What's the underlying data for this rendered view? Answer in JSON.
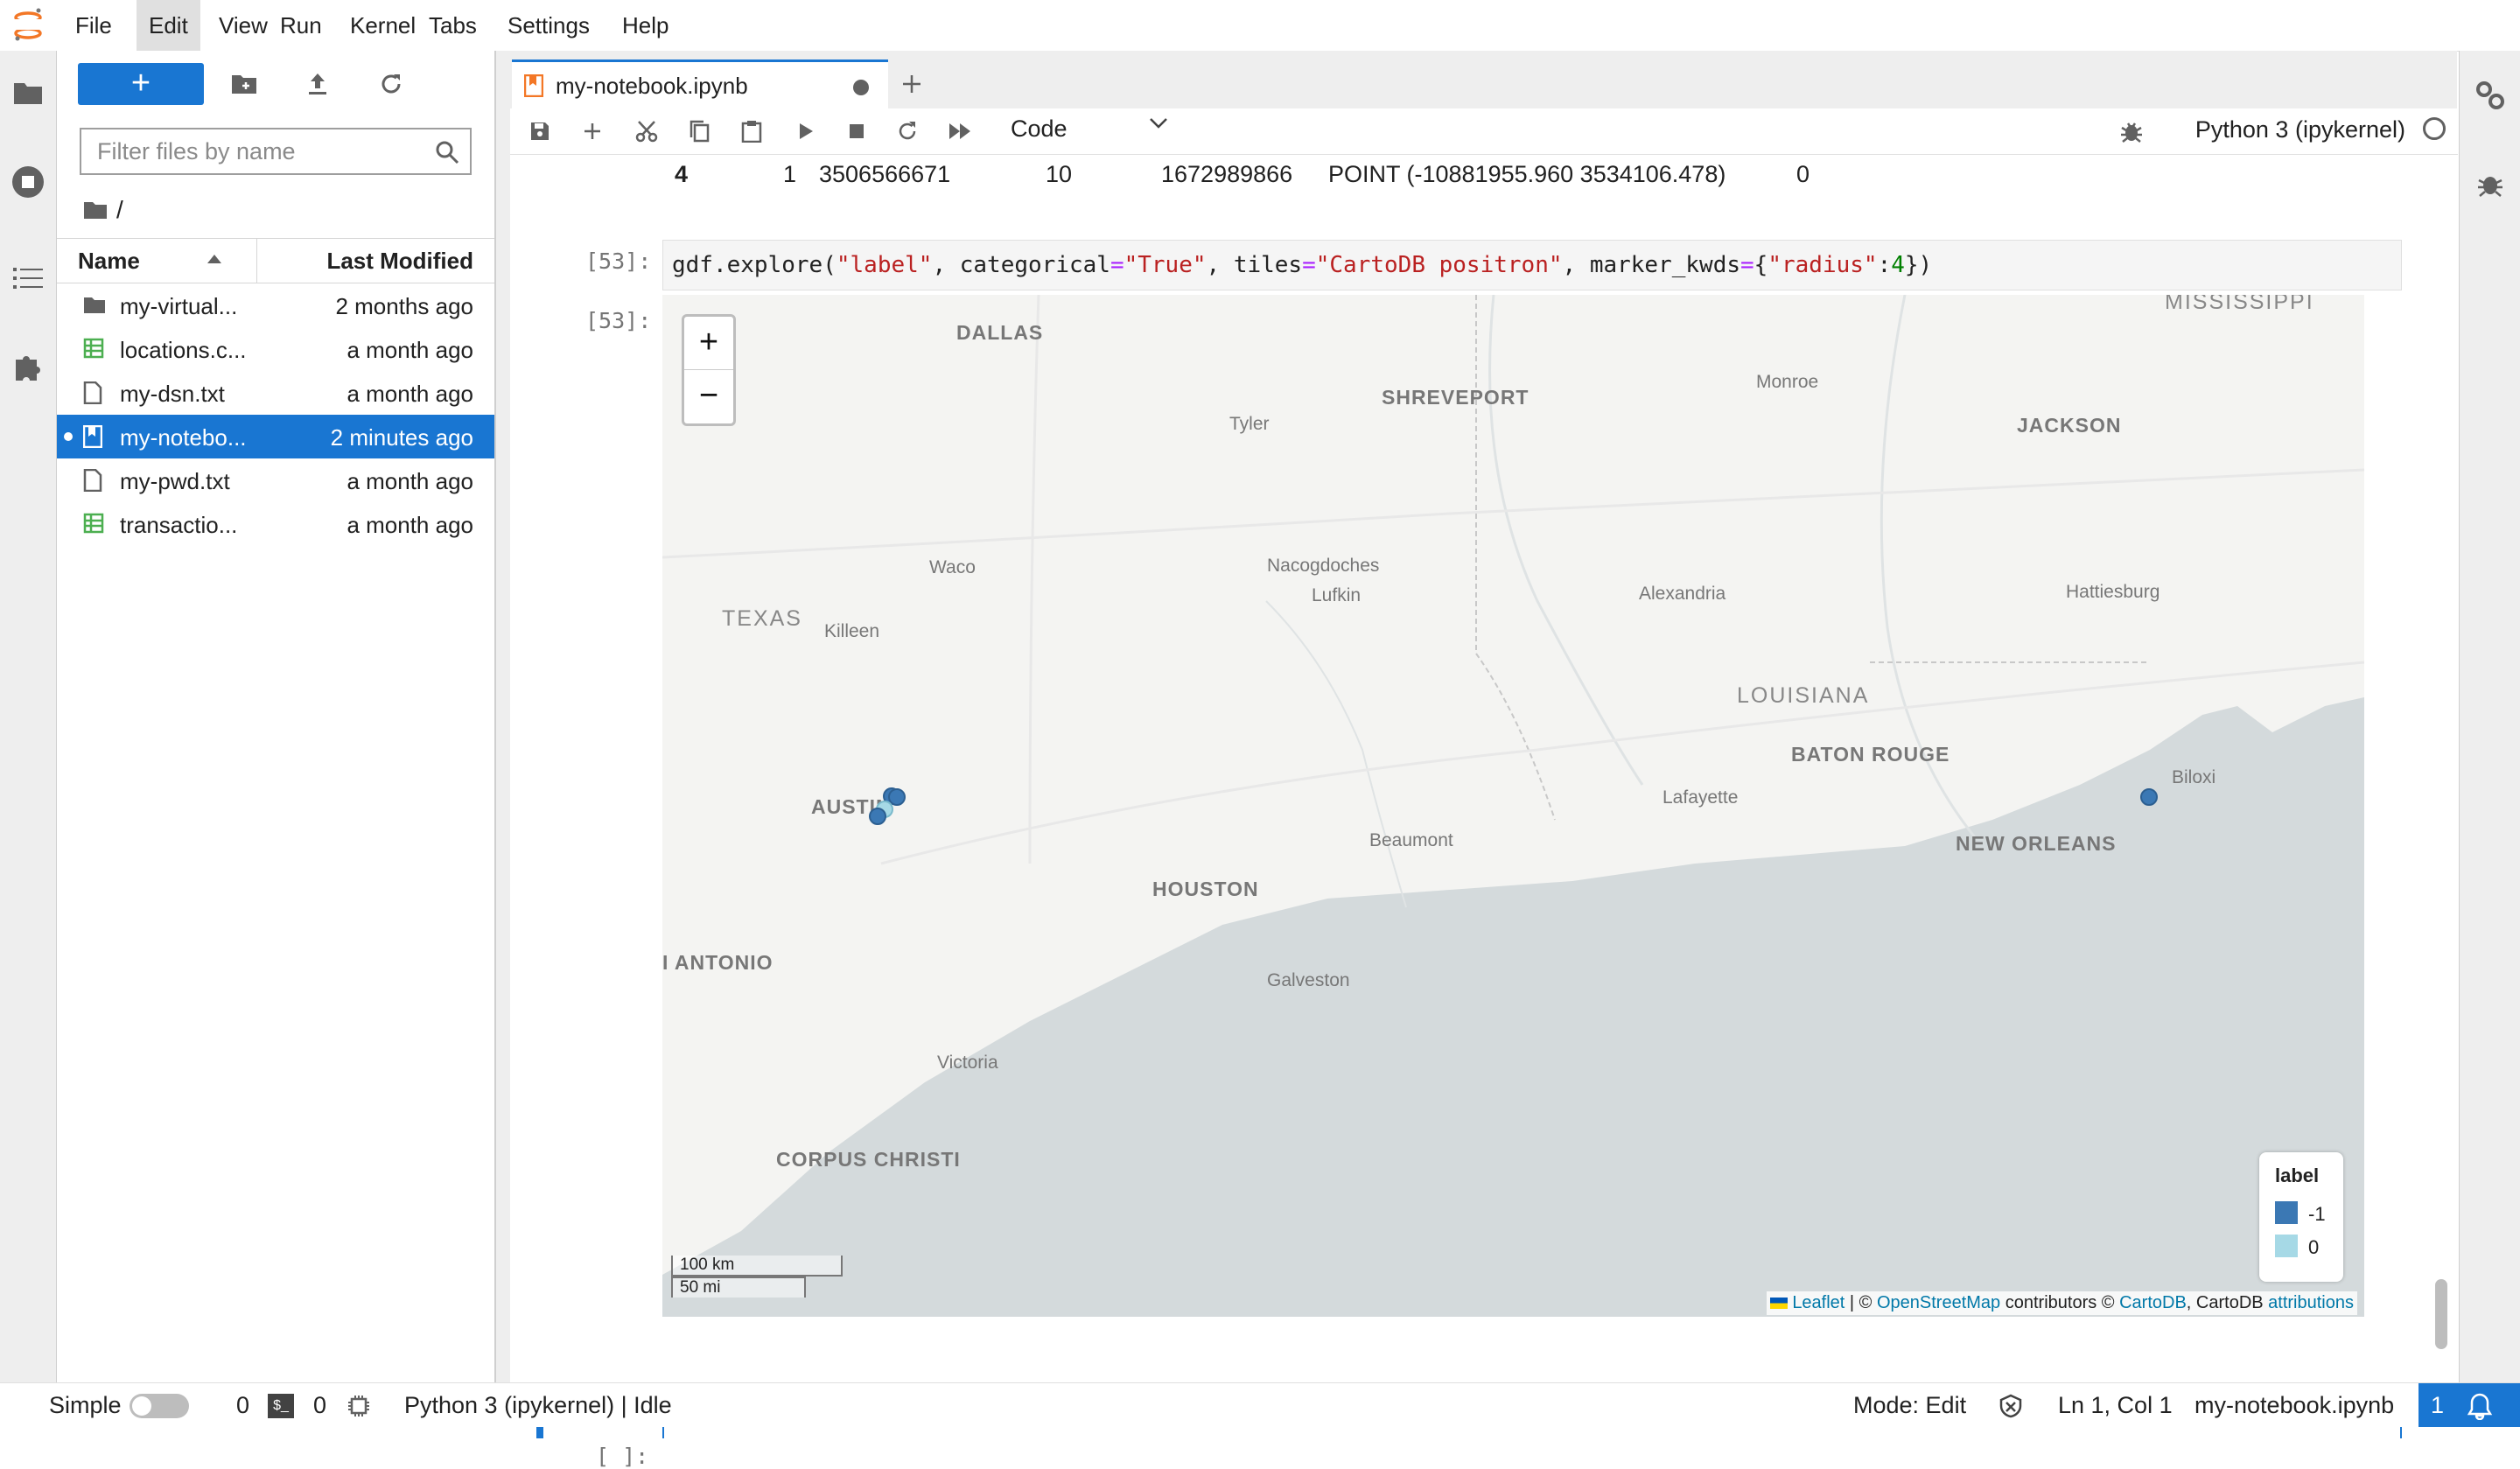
{
  "menubar": {
    "items": [
      "File",
      "Edit",
      "View",
      "Run",
      "Kernel",
      "Tabs",
      "Settings",
      "Help"
    ],
    "active": "Edit"
  },
  "filebrowser": {
    "filter_placeholder": "Filter files by name",
    "breadcrumb": "/",
    "header_name": "Name",
    "header_modified": "Last Modified",
    "files": [
      {
        "name": "my-virtual...",
        "modified": "2 months ago",
        "icon": "folder-icon"
      },
      {
        "name": "locations.c...",
        "modified": "a month ago",
        "icon": "spreadsheet-icon"
      },
      {
        "name": "my-dsn.txt",
        "modified": "a month ago",
        "icon": "file-icon"
      },
      {
        "name": "my-notebo...",
        "modified": "2 minutes ago",
        "icon": "notebook-icon",
        "selected": true
      },
      {
        "name": "my-pwd.txt",
        "modified": "a month ago",
        "icon": "file-icon"
      },
      {
        "name": "transactio...",
        "modified": "a month ago",
        "icon": "spreadsheet-icon"
      }
    ]
  },
  "tab": {
    "label": "my-notebook.ipynb"
  },
  "toolbar": {
    "cell_type": "Code",
    "kernel": "Python 3 (ipykernel)"
  },
  "output_row": {
    "index": "4",
    "c1": "1",
    "c2": "3506566671",
    "c3": "10",
    "c4": "1672989866",
    "c5": "POINT (-10881955.960 3534106.478)",
    "c6": "0"
  },
  "cell": {
    "in_prompt": "[53]:",
    "out_prompt": "[53]:",
    "code_parts": [
      {
        "t": "gdf",
        "c": "k-fn"
      },
      {
        "t": ".explore(",
        "c": "k-fn"
      },
      {
        "t": "\"label\"",
        "c": "k-str"
      },
      {
        "t": ", categorical",
        "c": "k-fn"
      },
      {
        "t": "=",
        "c": "k-op"
      },
      {
        "t": "\"True\"",
        "c": "k-str"
      },
      {
        "t": ", tiles",
        "c": "k-fn"
      },
      {
        "t": "=",
        "c": "k-op"
      },
      {
        "t": "\"CartoDB positron\"",
        "c": "k-str"
      },
      {
        "t": ", marker_kwds",
        "c": "k-fn"
      },
      {
        "t": "=",
        "c": "k-op"
      },
      {
        "t": "{",
        "c": "k-fn"
      },
      {
        "t": "\"radius\"",
        "c": "k-str"
      },
      {
        "t": ":",
        "c": "k-fn"
      },
      {
        "t": "4",
        "c": "k-num"
      },
      {
        "t": "})",
        "c": "k-fn"
      }
    ],
    "next_prompt": "[ ]:"
  },
  "map": {
    "zoom_in": "+",
    "zoom_out": "−",
    "labels": [
      {
        "text": "MISSISSIPPI",
        "cls": "state"
      },
      {
        "text": "DALLAS",
        "cls": "big"
      },
      {
        "text": "SHREVEPORT",
        "cls": "big"
      },
      {
        "text": "Monroe",
        "cls": ""
      },
      {
        "text": "JACKSON",
        "cls": "big"
      },
      {
        "text": "Tyler",
        "cls": ""
      },
      {
        "text": "Waco",
        "cls": ""
      },
      {
        "text": "Nacogdoches",
        "cls": ""
      },
      {
        "text": "TEXAS",
        "cls": "state"
      },
      {
        "text": "Lufkin",
        "cls": ""
      },
      {
        "text": "Alexandria",
        "cls": ""
      },
      {
        "text": "Hattiesburg",
        "cls": ""
      },
      {
        "text": "Killeen",
        "cls": ""
      },
      {
        "text": "LOUISIANA",
        "cls": "state"
      },
      {
        "text": "AUSTIN",
        "cls": "big"
      },
      {
        "text": "BATON ROUGE",
        "cls": "big"
      },
      {
        "text": "Biloxi",
        "cls": ""
      },
      {
        "text": "Lafayette",
        "cls": ""
      },
      {
        "text": "Beaumont",
        "cls": ""
      },
      {
        "text": "NEW ORLEANS",
        "cls": "big"
      },
      {
        "text": "HOUSTON",
        "cls": "big"
      },
      {
        "text": "I ANTONIO",
        "cls": "big"
      },
      {
        "text": "Galveston",
        "cls": ""
      },
      {
        "text": "Victoria",
        "cls": ""
      },
      {
        "text": "CORPUS CHRISTI",
        "cls": "big"
      }
    ],
    "legend": {
      "title": "label",
      "items": [
        {
          "value": "-1",
          "color": "#3b78b4"
        },
        {
          "value": "0",
          "color": "#a6d9e6"
        }
      ]
    },
    "scale": {
      "km": "100 km",
      "mi": "50 mi"
    },
    "attribution": {
      "leaflet": "Leaflet",
      "sep1": " | © ",
      "osm": "OpenStreetMap",
      "contrib": " contributors © ",
      "carto": "CartoDB",
      "sep2": ", CartoDB ",
      "attr": "attributions"
    }
  },
  "statusbar": {
    "mode_label": "Simple",
    "terminals": "0",
    "kernels": "0",
    "kernel_status": "Python 3 (ipykernel) | Idle",
    "edit_mode": "Mode: Edit",
    "cursor": "Ln 1, Col 1",
    "file": "my-notebook.ipynb",
    "notifications": "1"
  },
  "colors": {
    "accent": "#1976d2",
    "marker": "#3b78b4",
    "marker_light": "#a6d9e6"
  }
}
